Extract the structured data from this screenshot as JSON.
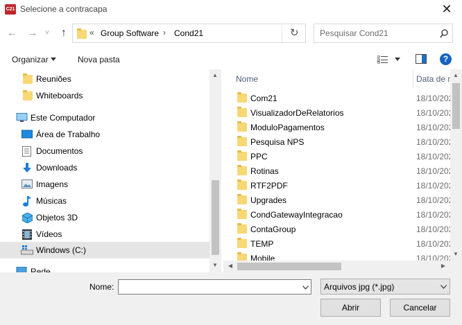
{
  "window": {
    "icon_text": "C21",
    "title": "Selecione a contracapa",
    "close_glyph": "✕"
  },
  "nav": {
    "back_glyph": "←",
    "forward_glyph": "→",
    "recent_glyph": "˅",
    "up_glyph": "↑",
    "breadcrumb_prefix": "«",
    "breadcrumb": [
      "Group Software",
      "Cond21"
    ],
    "separator": "›",
    "refresh_glyph": "↻",
    "search_placeholder": "Pesquisar Cond21"
  },
  "toolbar": {
    "organize_label": "Organizar",
    "new_folder_label": "Nova pasta",
    "help_glyph": "?"
  },
  "sidebar": {
    "items": [
      {
        "label": "Reuniões",
        "icon": "folder-icon"
      },
      {
        "label": "Whiteboards",
        "icon": "folder-icon"
      },
      {
        "label": "Este Computador",
        "icon": "computer-icon"
      },
      {
        "label": "Área de Trabalho",
        "icon": "desktop-icon"
      },
      {
        "label": "Documentos",
        "icon": "documents-icon"
      },
      {
        "label": "Downloads",
        "icon": "downloads-icon"
      },
      {
        "label": "Imagens",
        "icon": "pictures-icon"
      },
      {
        "label": "Músicas",
        "icon": "music-icon"
      },
      {
        "label": "Objetos 3D",
        "icon": "objects3d-icon"
      },
      {
        "label": "Vídeos",
        "icon": "videos-icon"
      },
      {
        "label": "Windows (C:)",
        "icon": "drive-icon"
      },
      {
        "label": "Rede",
        "icon": "network-icon"
      }
    ]
  },
  "files": {
    "columns": {
      "name": "Nome",
      "date": "Data de m"
    },
    "rows": [
      {
        "name": "Com21",
        "date": "18/10/202"
      },
      {
        "name": "VisualizadorDeRelatorios",
        "date": "18/10/202"
      },
      {
        "name": "ModuloPagamentos",
        "date": "18/10/202"
      },
      {
        "name": "Pesquisa NPS",
        "date": "18/10/202"
      },
      {
        "name": "PPC",
        "date": "18/10/202"
      },
      {
        "name": "Rotinas",
        "date": "18/10/202"
      },
      {
        "name": "RTF2PDF",
        "date": "18/10/202"
      },
      {
        "name": "Upgrades",
        "date": "18/10/202"
      },
      {
        "name": "CondGatewayIntegracao",
        "date": "18/10/202"
      },
      {
        "name": "ContaGroup",
        "date": "18/10/202"
      },
      {
        "name": "TEMP",
        "date": "18/10/202"
      },
      {
        "name": "Mobile",
        "date": "18/10/202"
      }
    ]
  },
  "footer": {
    "name_label": "Nome:",
    "name_value": "",
    "filter_value": "Arquivos jpg (*.jpg)",
    "open_label": "Abrir",
    "cancel_label": "Cancelar"
  }
}
